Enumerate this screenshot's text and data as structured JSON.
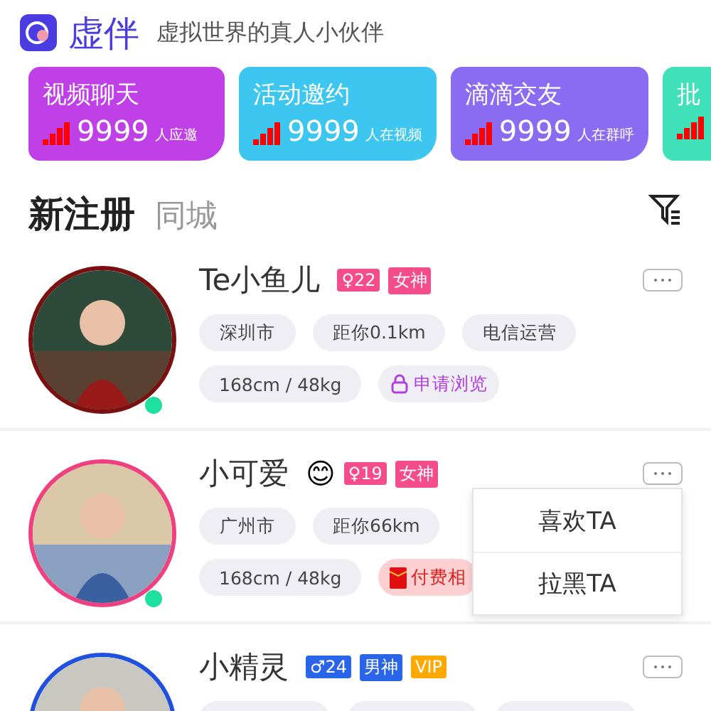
{
  "app": {
    "name": "虚伴",
    "slogan": "虚拟世界的真人小伙伴"
  },
  "banners": [
    {
      "title": "视频聊天",
      "count": "9999",
      "caption": "人应邀",
      "color": "#c040e8"
    },
    {
      "title": "活动邀约",
      "count": "9999",
      "caption": "人在视频",
      "color": "#3cc6f0"
    },
    {
      "title": "滴滴交友",
      "count": "9999",
      "caption": "人在群呼",
      "color": "#8a6cf2"
    },
    {
      "title": "批",
      "color": "#40e0b8"
    }
  ],
  "tabs": [
    {
      "label": "新注册",
      "selected": true
    },
    {
      "label": "同城",
      "selected": false
    }
  ],
  "users": [
    {
      "name": "Te小鱼儿",
      "age_badge": {
        "text": "♀22",
        "kind": "female"
      },
      "badges": [
        {
          "label": "女神",
          "kind": "goddess"
        }
      ],
      "color": "#7a1010",
      "online": true,
      "chip_rows": [
        [
          {
            "label": "深圳市",
            "kind": "plain"
          },
          {
            "label": "距你0.1km",
            "kind": "plain"
          },
          {
            "label": "电信运营",
            "kind": "plain"
          }
        ],
        [
          {
            "label": "168cm / 48kg",
            "kind": "plain"
          },
          {
            "label": "申请浏览",
            "kind": "lock"
          }
        ]
      ],
      "menu_open": false
    },
    {
      "name": "小可爱",
      "emoji": "😊",
      "age_badge": {
        "text": "♀19",
        "kind": "female"
      },
      "badges": [
        {
          "label": "女神",
          "kind": "goddess"
        }
      ],
      "color": "#f04080",
      "online": true,
      "chip_rows": [
        [
          {
            "label": "广州市",
            "kind": "plain"
          },
          {
            "label": "距你66km",
            "kind": "plain"
          }
        ],
        [
          {
            "label": "168cm / 48kg",
            "kind": "plain"
          },
          {
            "label": "付费相",
            "kind": "paid"
          }
        ]
      ],
      "menu_open": true
    },
    {
      "name": "小精灵",
      "age_badge": {
        "text": "♂24",
        "kind": "male"
      },
      "badges": [
        {
          "label": "男神",
          "kind": "god"
        },
        {
          "label": "VIP",
          "kind": "vip"
        }
      ],
      "color": "#2050e0",
      "online": false,
      "menu_open": false
    }
  ],
  "menu": [
    "喜欢TA",
    "拉黑TA"
  ]
}
